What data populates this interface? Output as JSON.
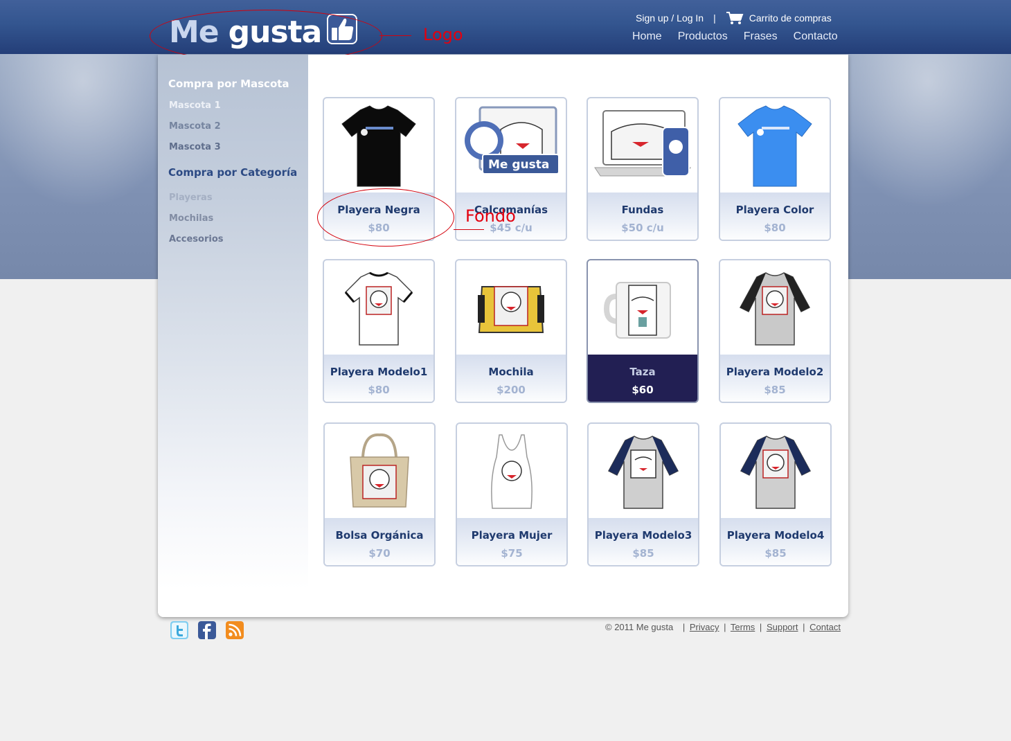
{
  "header": {
    "logo": {
      "word1": "Me",
      "word2": "gusta",
      "icon": "thumbs-up-icon"
    },
    "signup_login": "Sign up / Log In",
    "separator": "|",
    "cart_label": "Carrito de compras",
    "cart_icon": "cart-icon",
    "nav": [
      "Home",
      "Productos",
      "Frases",
      "Contacto"
    ]
  },
  "annotations": {
    "logo_label": "Logo",
    "background_label": "Fondo",
    "color": "#e3000f"
  },
  "sidebar": {
    "mascota_title": "Compra por Mascota",
    "mascota_items": [
      "Mascota 1",
      "Mascota 2",
      "Mascota 3"
    ],
    "categoria_title": "Compra por Categoría",
    "categoria_items": [
      "Playeras",
      "Mochilas",
      "Accesorios"
    ]
  },
  "products": [
    {
      "name": "Playera Negra",
      "price": "$80"
    },
    {
      "name": "Calcomanías",
      "price": "$45 c/u"
    },
    {
      "name": "Fundas",
      "price": "$50 c/u"
    },
    {
      "name": "Playera Color",
      "price": "$80"
    },
    {
      "name": "Playera Modelo1",
      "price": "$80"
    },
    {
      "name": "Mochila",
      "price": "$200"
    },
    {
      "name": "Taza",
      "price": "$60",
      "selected": true
    },
    {
      "name": "Playera Modelo2",
      "price": "$85"
    },
    {
      "name": "Bolsa Orgánica",
      "price": "$70"
    },
    {
      "name": "Playera Mujer",
      "price": "$75"
    },
    {
      "name": "Playera Modelo3",
      "price": "$85"
    },
    {
      "name": "Playera Modelo4",
      "price": "$85"
    }
  ],
  "footer": {
    "copyright": "© 2011   Me gusta",
    "links": [
      "Privacy",
      "Terms",
      "Support",
      "Contact"
    ],
    "social_icons": [
      "twitter-icon",
      "facebook-icon",
      "rss-icon"
    ]
  },
  "colors": {
    "brand_blue": "#33558f",
    "selected_tile": "#221f53",
    "title_blue": "#1f3a6e",
    "price_grey_blue": "#a3b3d1"
  }
}
